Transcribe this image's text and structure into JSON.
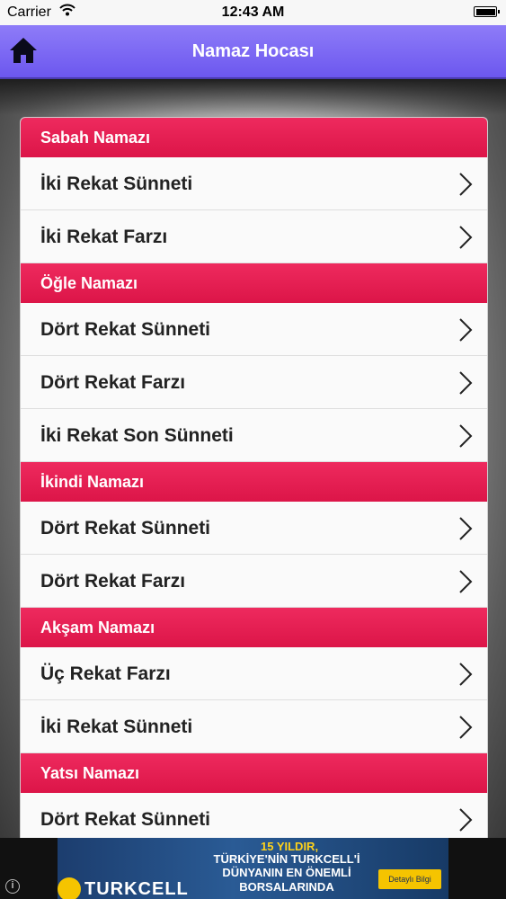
{
  "status_bar": {
    "carrier": "Carrier",
    "time": "12:43 AM"
  },
  "nav": {
    "title": "Namaz Hocası",
    "home_icon": "home-icon"
  },
  "sections": [
    {
      "header": "Sabah Namazı",
      "rows": [
        "İki Rekat Sünneti",
        "İki Rekat Farzı"
      ]
    },
    {
      "header": "Öğle Namazı",
      "rows": [
        "Dört Rekat Sünneti",
        "Dört Rekat Farzı",
        "İki Rekat Son Sünneti"
      ]
    },
    {
      "header": "İkindi Namazı",
      "rows": [
        "Dört Rekat Sünneti",
        "Dört Rekat Farzı"
      ]
    },
    {
      "header": "Akşam Namazı",
      "rows": [
        "Üç Rekat Farzı",
        "İki Rekat Sünneti"
      ]
    },
    {
      "header": "Yatsı Namazı",
      "rows": [
        "Dört Rekat Sünneti"
      ]
    }
  ],
  "ad": {
    "logo": "TURKCELL",
    "years": "15 YILDIR,",
    "line1": "TÜRKİYE'NİN TURKCELL'İ",
    "line2": "DÜNYANIN EN ÖNEMLİ",
    "line3": "BORSALARINDA",
    "cta": "Detaylı Bilgi"
  },
  "colors": {
    "nav": "#7a66f3",
    "section_header": "#e41c50",
    "row_bg": "#fafafa"
  }
}
